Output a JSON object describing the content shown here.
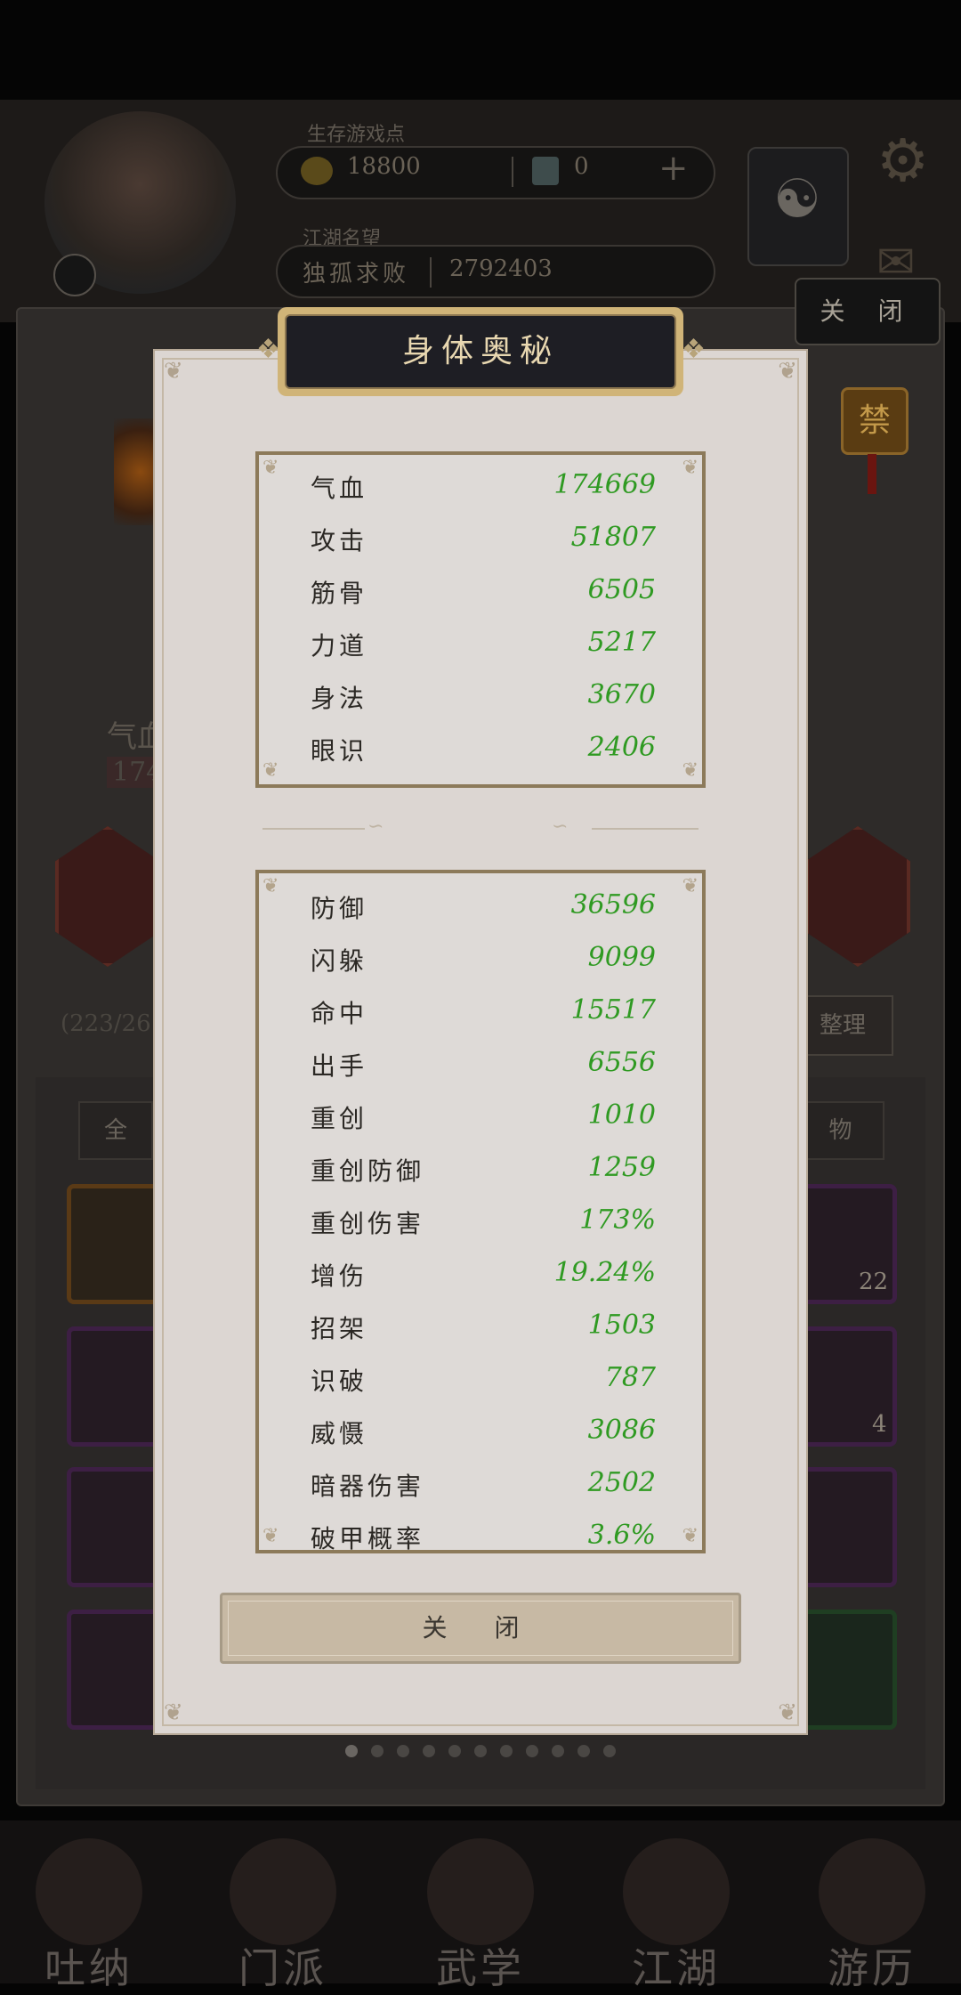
{
  "header": {
    "currency_label": "生存游戏点",
    "gold_amount": "18800",
    "ticket_amount": "0",
    "plus_label": "+",
    "reputation_label": "江湖名望",
    "reputation_title": "独孤求败",
    "reputation_value": "2792403",
    "close_label": "关 闭",
    "ban_label": "禁"
  },
  "background": {
    "left_stat_label": "气血",
    "left_stat_value": "174",
    "bag_count": "(223/26",
    "tidy_button": "整理",
    "tab_all": "全",
    "tab_items": "物",
    "slot_counts": [
      "22",
      "4"
    ],
    "nav": [
      "吐纳",
      "门派",
      "武学",
      "江湖",
      "游历"
    ]
  },
  "modal": {
    "title": "身体奥秘",
    "close_button": "关 闭",
    "section1": [
      {
        "name": "气血",
        "value": "174669"
      },
      {
        "name": "攻击",
        "value": "51807"
      },
      {
        "name": "筋骨",
        "value": "6505"
      },
      {
        "name": "力道",
        "value": "5217"
      },
      {
        "name": "身法",
        "value": "3670"
      },
      {
        "name": "眼识",
        "value": "2406"
      }
    ],
    "section2": [
      {
        "name": "防御",
        "value": "36596"
      },
      {
        "name": "闪躲",
        "value": "9099"
      },
      {
        "name": "命中",
        "value": "15517"
      },
      {
        "name": "出手",
        "value": "6556"
      },
      {
        "name": "重创",
        "value": "1010"
      },
      {
        "name": "重创防御",
        "value": "1259"
      },
      {
        "name": "重创伤害",
        "value": "173%"
      },
      {
        "name": "增伤",
        "value": "19.24%"
      },
      {
        "name": "招架",
        "value": "1503"
      },
      {
        "name": "识破",
        "value": "787"
      },
      {
        "name": "威慑",
        "value": "3086"
      },
      {
        "name": "暗器伤害",
        "value": "2502"
      },
      {
        "name": "破甲概率",
        "value": "3.6%"
      }
    ]
  },
  "pager": {
    "count": 11,
    "active": 0
  },
  "colors": {
    "stat_value": "#2f9a22",
    "modal_bg": "#dcd6d2",
    "title_bg": "#1e1e24",
    "title_text": "#e8d7b0"
  }
}
